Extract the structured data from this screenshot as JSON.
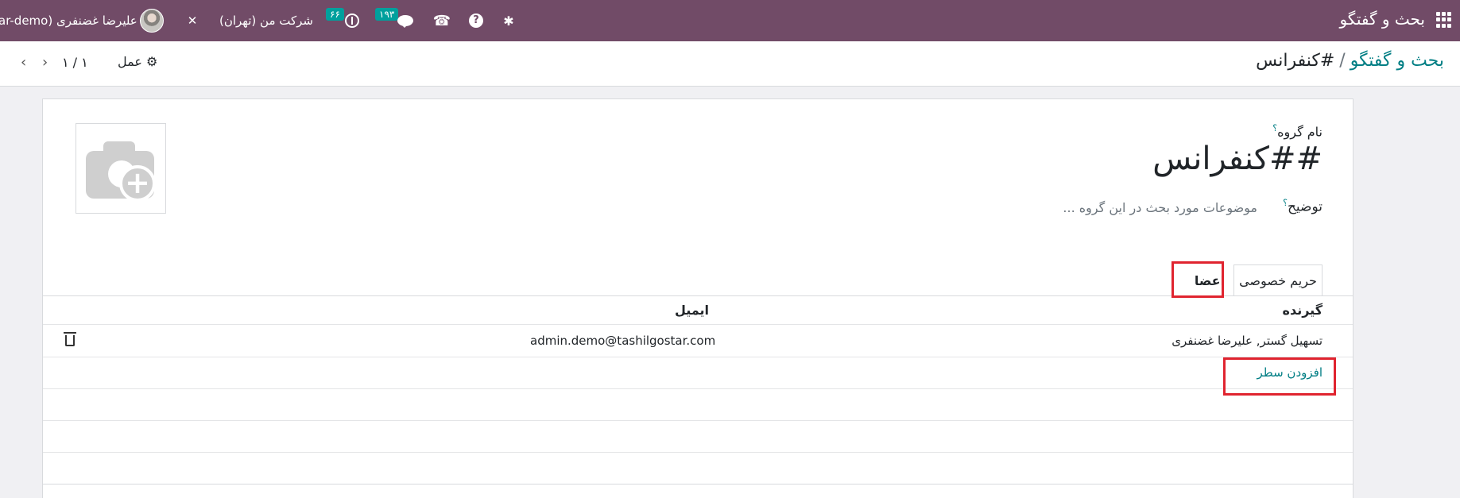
{
  "navbar": {
    "app_title": "بحث و گفتگو",
    "user_name": "علیرضا غضنفری (ar-demo",
    "company": "شرکت من (تهران)",
    "activity_count": "۶۶",
    "message_count": "۱۹۳",
    "icons": [
      "apps-grid-icon",
      "tools-icon",
      "activity-clock-icon",
      "chat-icon",
      "phone-icon",
      "help-icon",
      "bug-icon"
    ]
  },
  "control_panel": {
    "breadcrumb_parent": "بحث و گفتگو",
    "breadcrumb_sep": "/",
    "breadcrumb_current": "#کنفرانس",
    "action_label": "عمل",
    "pager_value": "۱ / ۱"
  },
  "form": {
    "name_label": "نام گروه",
    "help_mark": "؟",
    "group_name": "##کنفرانس",
    "description_label": "توضیح",
    "description_placeholder": "موضوعات مورد بحث در این گروه ..."
  },
  "tabs": [
    {
      "label": "حریم خصوصی"
    },
    {
      "label": "اعضا"
    }
  ],
  "table": {
    "columns": {
      "recipient": "گیرنده",
      "email": "ایمیل"
    },
    "rows": [
      {
        "recipient": "تسهیل گستر, علیرضا غضنفری",
        "email": "admin.demo@tashilgostar.com"
      }
    ],
    "add_line": "افزودن سطر"
  },
  "colors": {
    "navbar": "#714b67",
    "link": "#017e84",
    "badge": "#00a09d",
    "highlight": "#e0242f"
  }
}
